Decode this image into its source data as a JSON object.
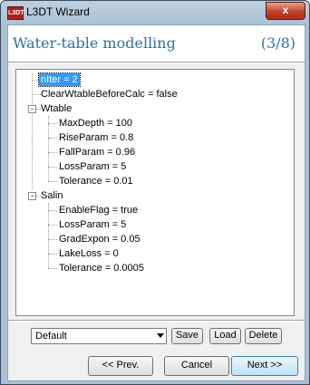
{
  "window": {
    "title": "L3DT Wizard",
    "icon_text": "L3DT",
    "close_glyph": "x"
  },
  "header": {
    "title": "Water-table modelling",
    "step": "(3/8)"
  },
  "tree": {
    "nIter": "nIter = 2",
    "ClearWtable": "ClearWtableBeforeCalc = false",
    "Wtable": {
      "label": "Wtable",
      "MaxDepth": "MaxDepth = 100",
      "RiseParam": "RiseParam = 0.8",
      "FallParam": "FallParam = 0.96",
      "LossParam": "LossParam = 5",
      "Tolerance": "Tolerance = 0.01"
    },
    "Salin": {
      "label": "Salin",
      "EnableFlag": "EnableFlag = true",
      "LossParam": "LossParam = 5",
      "GradExpon": "GradExpon = 0.05",
      "LakeLoss": "LakeLoss = 0",
      "Tolerance": "Tolerance = 0.0005"
    },
    "collapse_glyph": "-"
  },
  "presets": {
    "selected": "Default",
    "save": "Save",
    "load": "Load",
    "delete": "Delete"
  },
  "nav": {
    "prev": "<< Prev.",
    "cancel": "Cancel",
    "next": "Next >>"
  }
}
